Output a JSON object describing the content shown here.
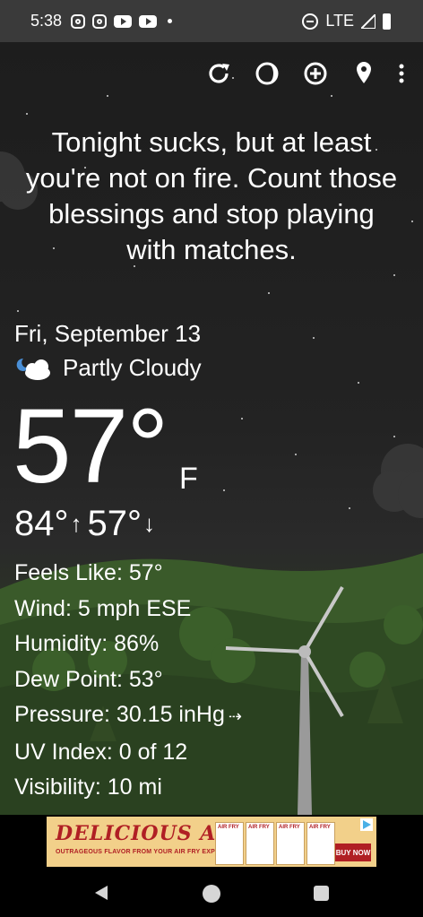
{
  "status_bar": {
    "time": "5:38",
    "notification_icons": [
      "instagram-icon",
      "instagram-icon",
      "youtube-icon",
      "youtube-icon",
      "dot-icon"
    ],
    "network": "LTE"
  },
  "toolbar": {
    "icons": [
      "refresh-icon",
      "theme-icon",
      "add-location-icon",
      "location-pin-icon",
      "more-vert-icon"
    ]
  },
  "quote": "Tonight sucks, but at least you're not on fire. Count those blessings and stop playing with matches.",
  "weather": {
    "date": "Fri, September 13",
    "condition": "Partly Cloudy",
    "condition_icon": "partly-cloudy-night-icon",
    "temperature": "57°",
    "unit": "F",
    "high": "84°",
    "high_arrow": "↑",
    "low": "57°",
    "low_arrow": "↓"
  },
  "details": {
    "feels_like": "Feels Like:  57°",
    "wind": "Wind:  5 mph ESE",
    "humidity": "Humidity:  86%",
    "dew_point": "Dew Point:  53°",
    "pressure": "Pressure:  30.15 inHg",
    "pressure_trend": "⇢",
    "uv_index": "UV Index:  0 of 12",
    "visibility": "Visibility:  10 mi"
  },
  "ad": {
    "brand": "DELICIOUS AF",
    "tagline": "OUTRAGEOUS FLAVOR FROM YOUR AIR FRY EXPERTS!",
    "product_label": "AIR FRY",
    "cta": "BUY NOW"
  },
  "colors": {
    "status_bar": "#3a3a3a",
    "sky": "#1f1f1f",
    "grass": "#2c3d24",
    "ad_red": "#b01f24",
    "ad_bg": "#f2d08a"
  }
}
